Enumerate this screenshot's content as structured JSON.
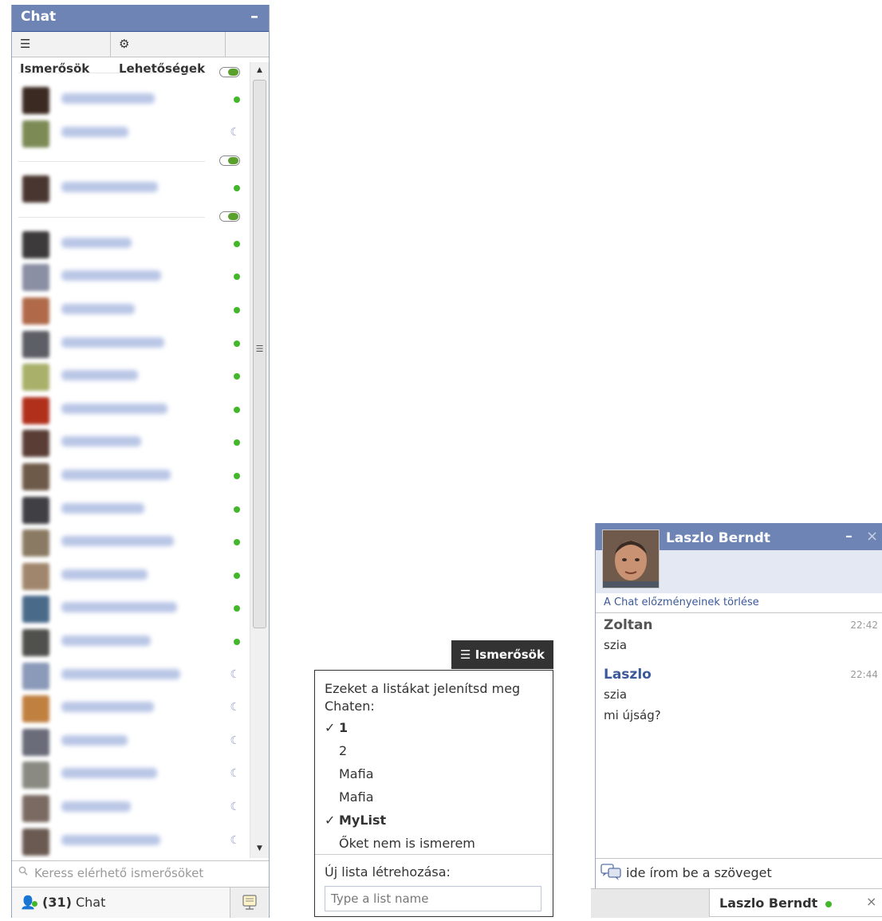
{
  "chat": {
    "title": "Chat",
    "minimize_label": "–",
    "tabs": {
      "friends_label": "Ismerősök",
      "options_label": "Lehetőségek"
    },
    "search_placeholder": "Keress elérhető ismerősöket",
    "status": {
      "count_text": "(31)",
      "label": "Chat"
    },
    "icons": [
      "list-icon",
      "gear-icon",
      "search-icon",
      "user-icon",
      "chat-settings-icon",
      "toggle-icon",
      "online-dot-icon",
      "idle-moon-icon"
    ]
  },
  "colors": {
    "header_blue": "#6d84b4",
    "brand_blue": "#3b5998",
    "online_green": "#42b72a"
  },
  "dropdown": {
    "tab_label": "Ismerősök",
    "heading": "Ezeket a listákat jelenítsd meg Chaten:",
    "items": [
      {
        "label": "1",
        "checked": true,
        "check": "✓"
      },
      {
        "label": "2",
        "checked": false,
        "check": ""
      },
      {
        "label": "Mafia",
        "checked": false,
        "check": ""
      },
      {
        "label": "Mafia",
        "checked": false,
        "check": ""
      },
      {
        "label": "MyList",
        "checked": true,
        "check": "✓"
      },
      {
        "label": "Őket nem is ismerem",
        "checked": false,
        "check": ""
      }
    ],
    "new_list_label": "Új lista létrehozása:",
    "new_list_placeholder": "Type a list name"
  },
  "conversation": {
    "name": "Laszlo Berndt",
    "minimize_label": "–",
    "close_label": "×",
    "clear_history": "A Chat előzményeinek törlése",
    "messages": [
      {
        "sender": "Zoltan",
        "time": "22:42",
        "lines": [
          "szia"
        ]
      },
      {
        "sender": "Laszlo",
        "time": "22:44",
        "lines": [
          "szia",
          "mi újság?"
        ]
      }
    ],
    "compose_placeholder": "ide írom be a szöveget"
  },
  "tabbar": {
    "name": "Laszlo Berndt",
    "close_label": "×"
  }
}
